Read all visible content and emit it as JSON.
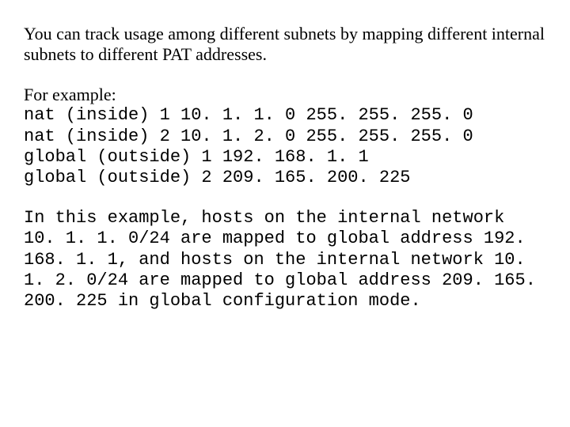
{
  "intro": "You can track usage among different subnets by mapping different internal subnets to different PAT addresses.",
  "example_label": "For example:",
  "code": {
    "line1": "nat (inside) 1 10. 1. 1. 0 255. 255. 255. 0",
    "line2": "nat (inside) 2 10. 1. 2. 0 255. 255. 255. 0",
    "line3": "global (outside) 1 192. 168. 1. 1",
    "line4": "global (outside) 2 209. 165. 200. 225"
  },
  "explanation": "In this example, hosts on the internal network 10. 1. 1. 0/24 are mapped to global address 192. 168. 1. 1, and hosts on the internal network 10. 1. 2. 0/24 are mapped to global address 209. 165. 200. 225 in global configuration mode."
}
